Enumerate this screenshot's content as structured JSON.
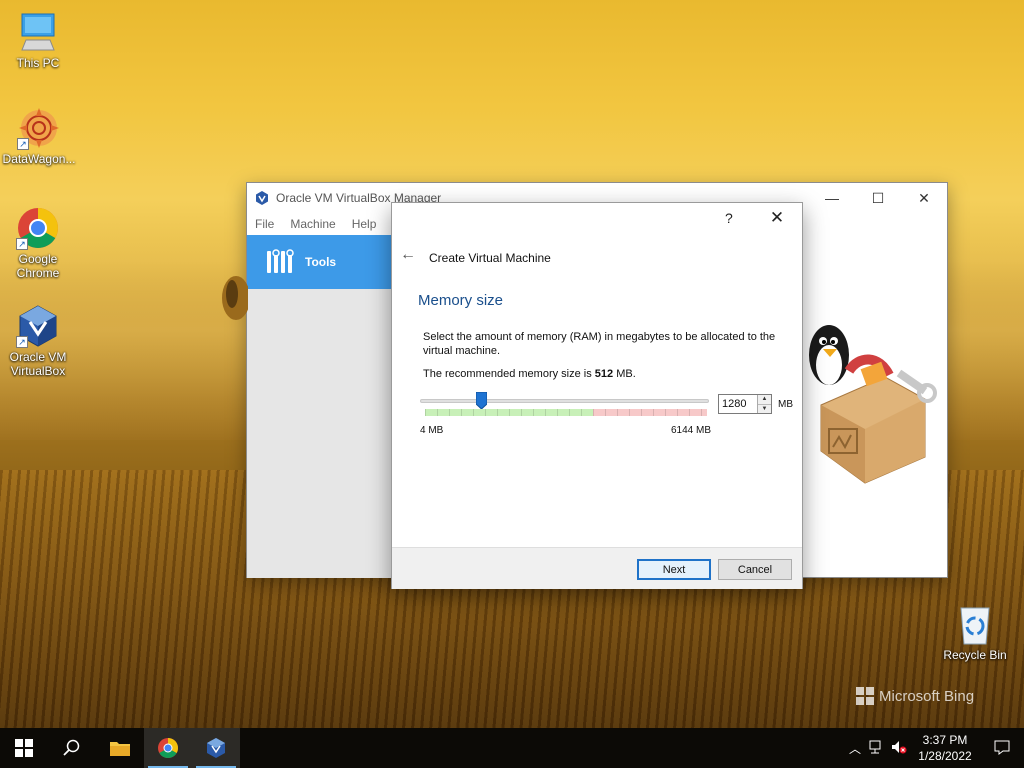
{
  "desktop": {
    "icons": [
      {
        "label": "This PC"
      },
      {
        "label": "DataWagon..."
      },
      {
        "label": "Google Chrome"
      },
      {
        "label": "Oracle VM VirtualBox"
      },
      {
        "label": "Recycle Bin"
      }
    ],
    "watermark": "Microsoft Bing"
  },
  "vbox_manager": {
    "title": "Oracle VM VirtualBox Manager",
    "menu": [
      "File",
      "Machine",
      "Help"
    ],
    "tools_label": "Tools"
  },
  "wizard": {
    "help_glyph": "?",
    "close_glyph": "✕",
    "back_glyph": "←",
    "title": "Create Virtual Machine",
    "heading": "Memory size",
    "description": "Select the amount of memory (RAM) in megabytes to be allocated to the virtual machine.",
    "recommended_prefix": "The recommended memory size is ",
    "recommended_value": "512",
    "recommended_suffix": " MB.",
    "memory_value": "1280",
    "unit": "MB",
    "slider": {
      "min_label": "4 MB",
      "max_label": "6144 MB",
      "min_mb": 4,
      "max_mb": 6144,
      "value_mb": 1280
    },
    "buttons": {
      "next": "Next",
      "cancel": "Cancel"
    }
  },
  "taskbar": {
    "clock_time": "3:37 PM",
    "clock_date": "1/28/2022"
  },
  "colors": {
    "selection_blue": "#3d9ae8",
    "heading_blue": "#1a4f8c",
    "slider_green": "#c8f0b8",
    "slider_red": "#f7c9c9"
  }
}
